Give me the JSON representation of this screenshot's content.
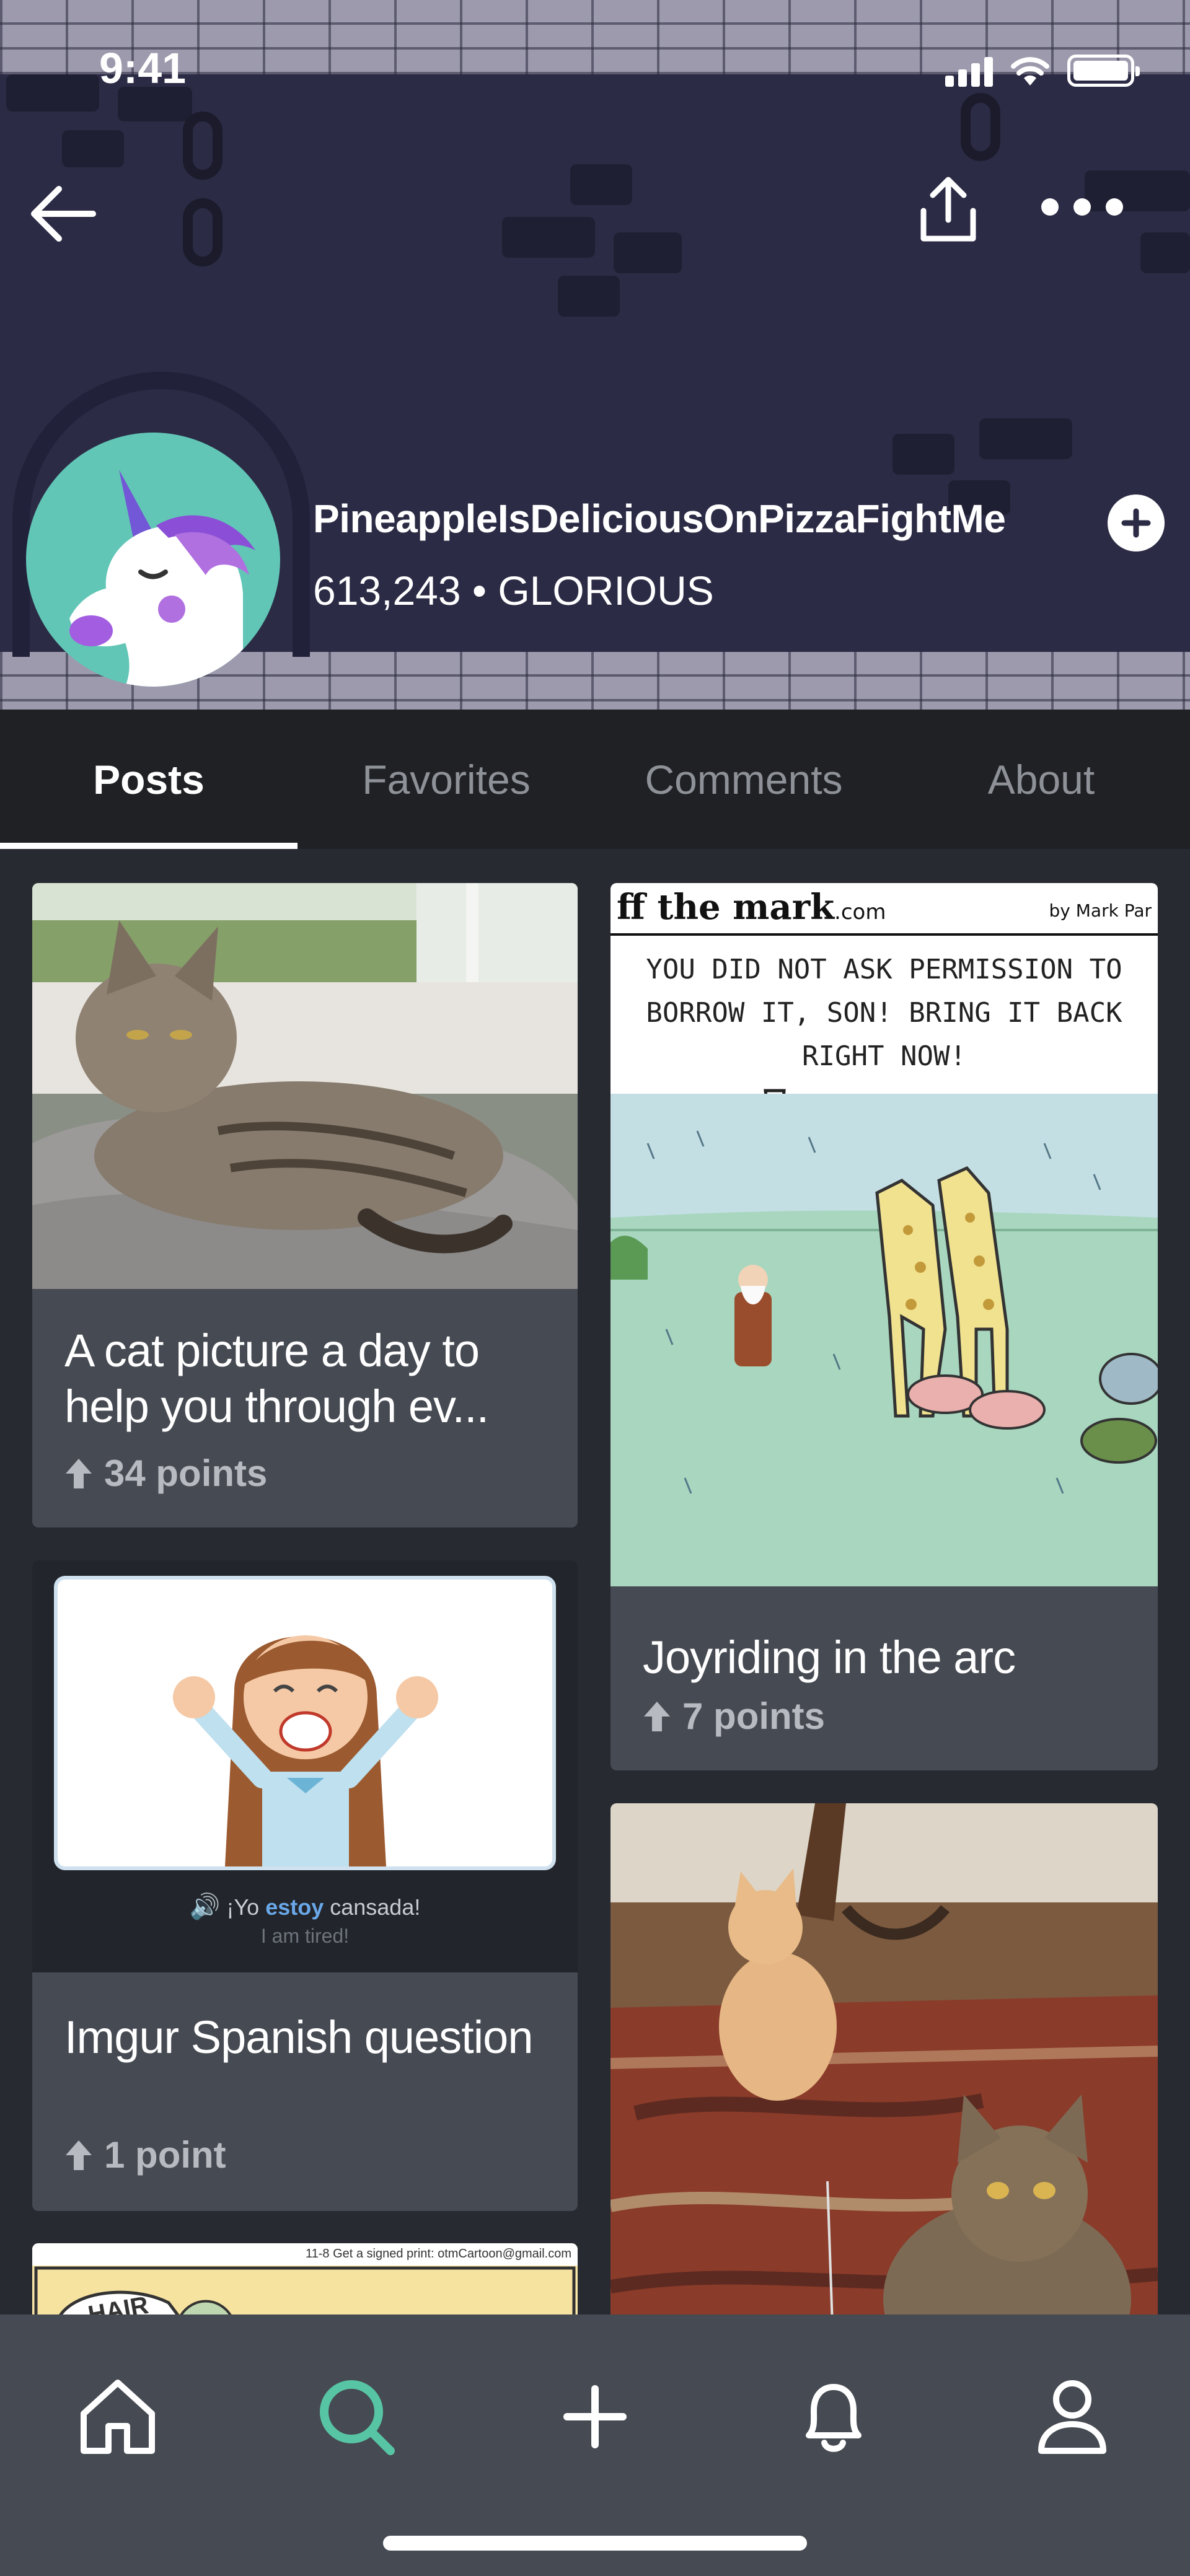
{
  "status_bar": {
    "time": "9:41"
  },
  "profile": {
    "username": "PineappleIsDeliciousOnPizzaFightMe",
    "points": "613,243",
    "separator": "•",
    "title": "GLORIOUS"
  },
  "tabs": [
    {
      "label": "Posts",
      "active": true
    },
    {
      "label": "Favorites",
      "active": false
    },
    {
      "label": "Comments",
      "active": false
    },
    {
      "label": "About",
      "active": false
    }
  ],
  "posts": [
    {
      "title": "A cat picture a day to help you through ev...",
      "points": "34 points"
    },
    {
      "title": "Joyriding in the arc",
      "points": "7 points"
    },
    {
      "title": "Imgur Spanish question",
      "points": "1 point"
    }
  ],
  "comic": {
    "header": "ff the mark",
    "domain": ".com",
    "byline": "by Mark Par",
    "speech": "YOU DID NOT ASK PERMISSION TO BORROW IT, SON! BRING IT BACK RIGHT NOW!"
  },
  "spanish_card": {
    "phrase_pre": "¡Yo ",
    "phrase_highlight": "estoy",
    "phrase_post": " cansada!",
    "translation": "I am tired!"
  },
  "small_comic": {
    "caption": "11-8  Get a signed print: otmCartoon@gmail.com",
    "balloon": "HAIR"
  },
  "bottom_nav": [
    "home-icon",
    "search-icon",
    "add-icon",
    "bell-icon",
    "profile-icon"
  ],
  "colors": {
    "header_bg": "#2b2b45",
    "page_bg": "#272a31",
    "card_bg": "#464a52",
    "accent": "#57c5a4",
    "avatar_bg": "#62c6b6"
  }
}
